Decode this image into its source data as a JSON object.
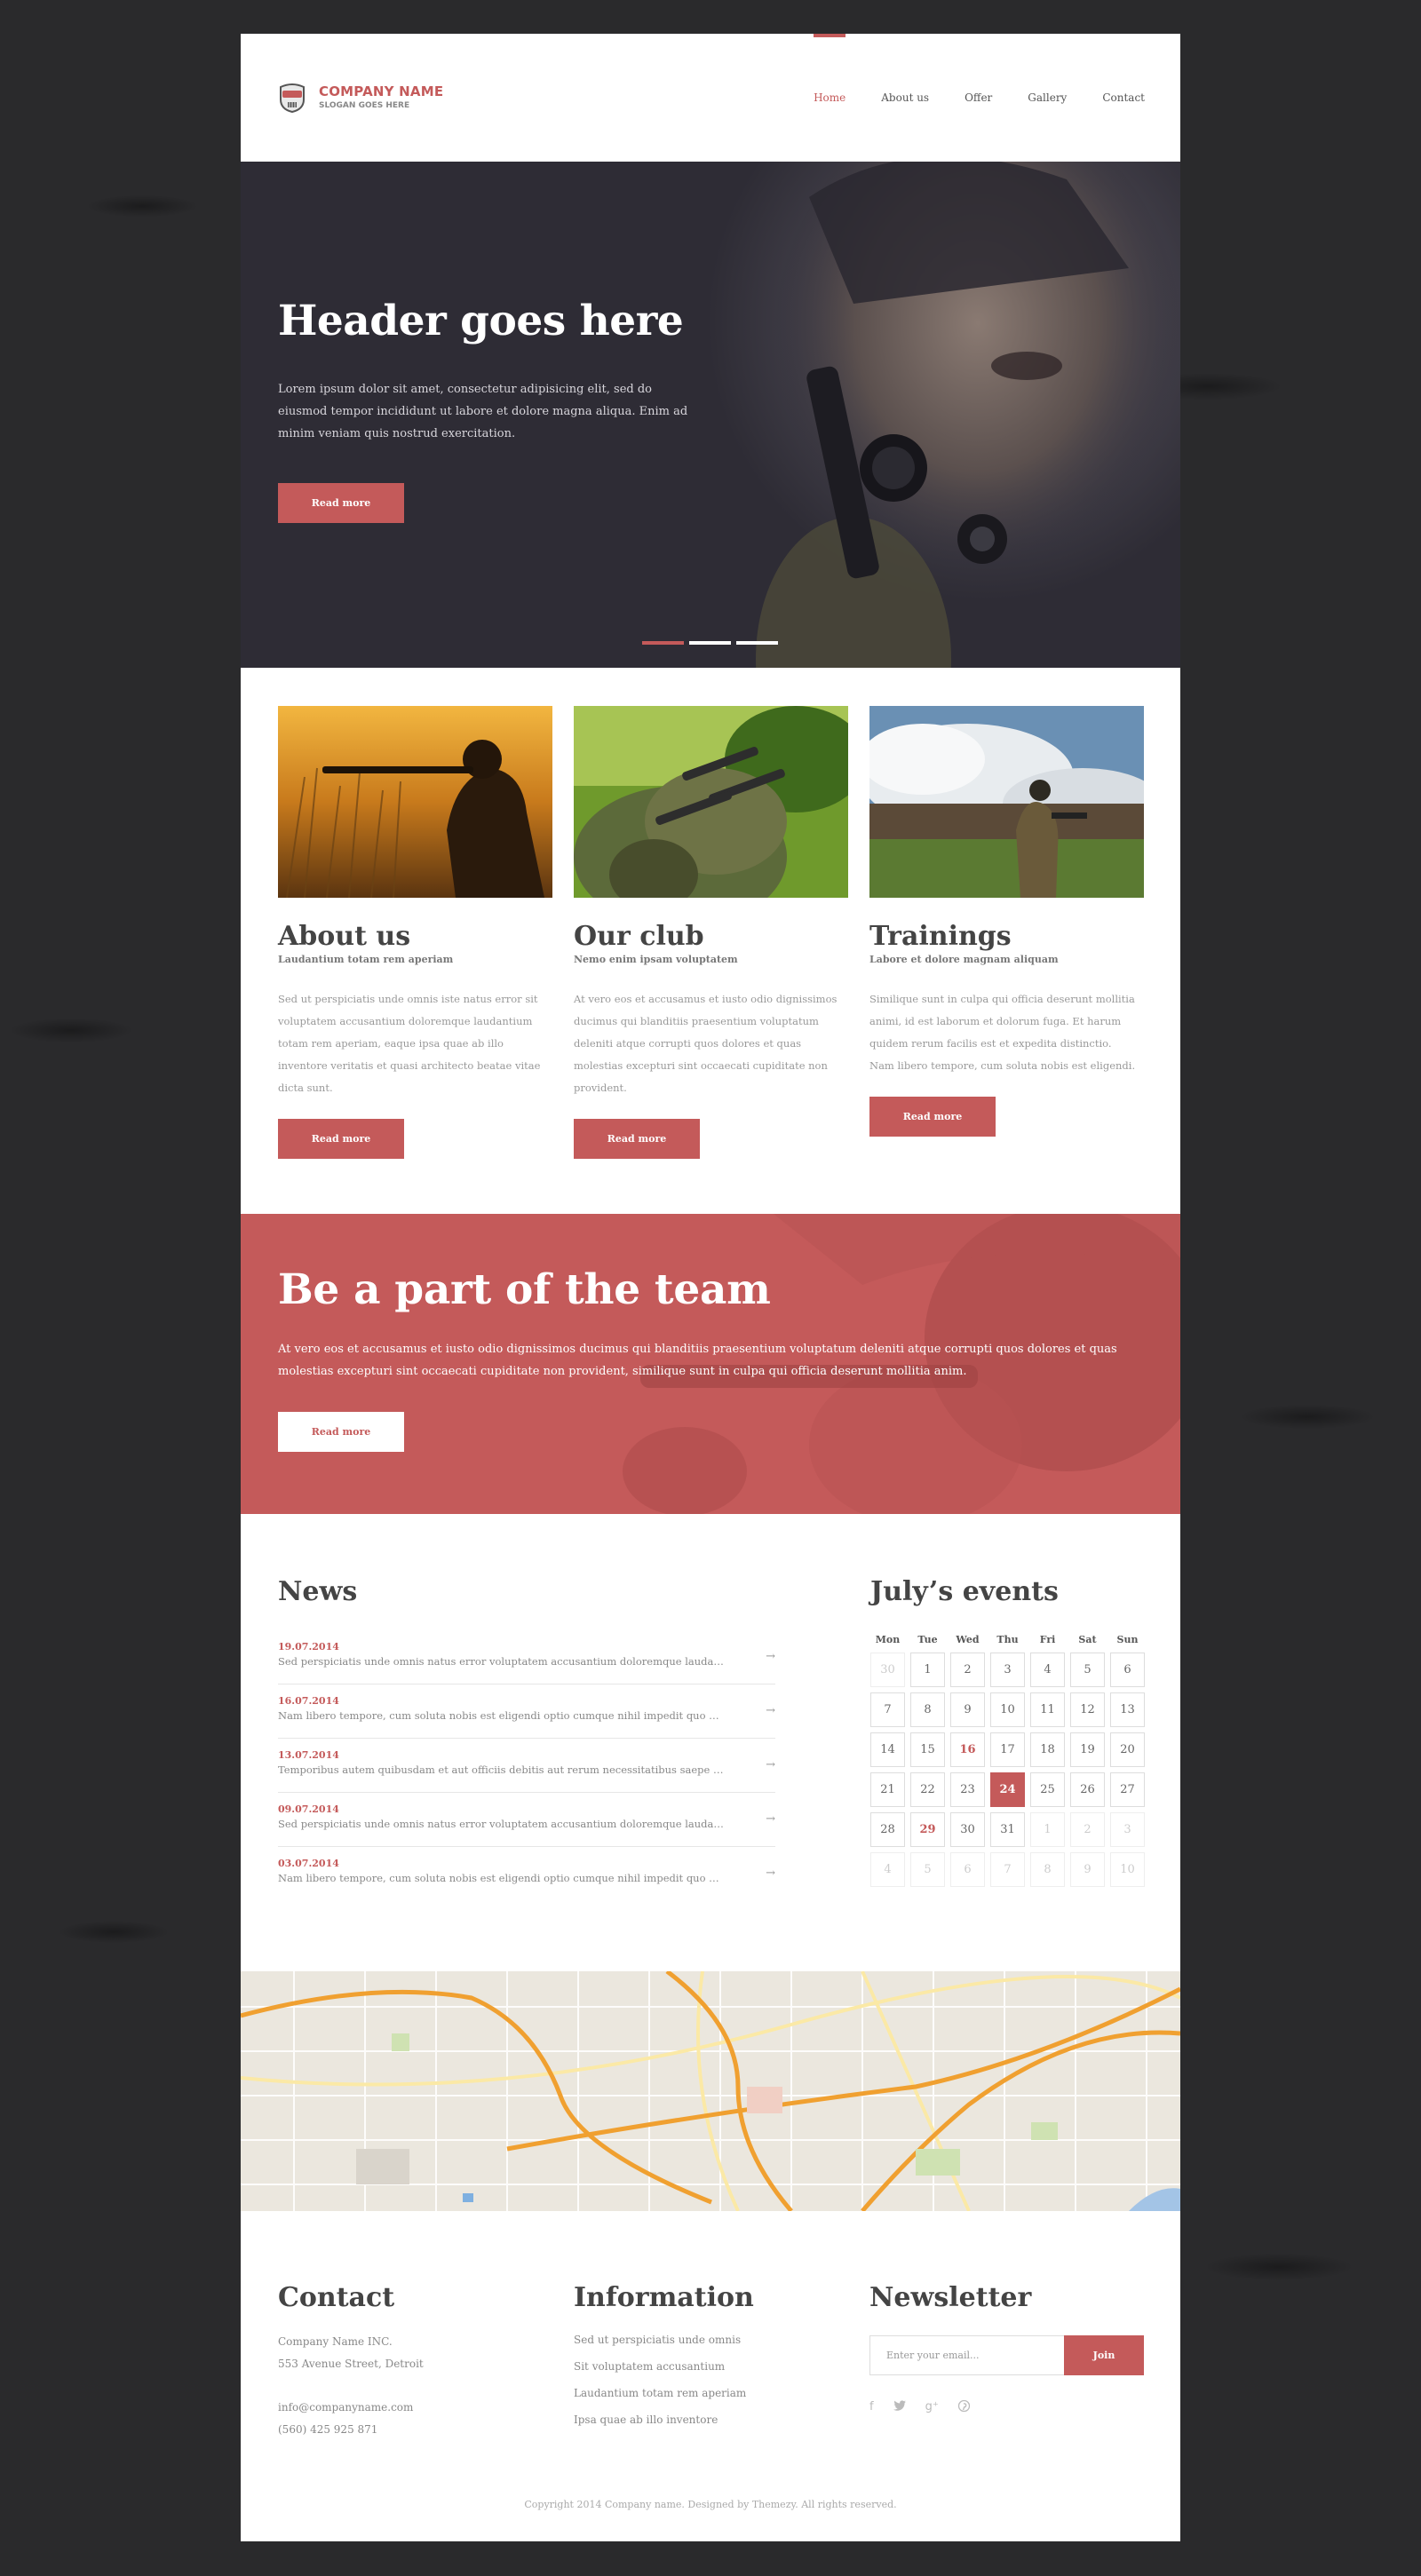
{
  "brand": {
    "name": "COMPANY NAME",
    "slogan": "SLOGAN GOES HERE",
    "accent": "#c45a5a"
  },
  "nav": {
    "items": [
      {
        "label": "Home",
        "active": true
      },
      {
        "label": "About us"
      },
      {
        "label": "Offer"
      },
      {
        "label": "Gallery"
      },
      {
        "label": "Contact"
      }
    ]
  },
  "hero": {
    "title": "Header goes here",
    "text": "Lorem ipsum dolor sit amet, consectetur adipisicing elit, sed do eiusmod tempor incididunt ut labore et dolore magna aliqua. Enim ad minim veniam quis nostrud exercitation.",
    "button": "Read more",
    "slides": 3,
    "active_slide": 1
  },
  "features": [
    {
      "title": "About us",
      "subtitle": "Laudantium totam rem aperiam",
      "text": "Sed ut perspiciatis unde omnis iste natus error sit voluptatem accusantium doloremque laudantium totam rem aperiam, eaque ipsa quae ab illo inventore veritatis et quasi architecto beatae vitae dicta sunt.",
      "button": "Read more"
    },
    {
      "title": "Our club",
      "subtitle": "Nemo enim ipsam voluptatem",
      "text": "At vero eos et accusamus et iusto odio dignissimos ducimus qui blanditiis praesentium voluptatum deleniti atque corrupti quos dolores et quas molestias excepturi sint occaecati cupiditate non provident.",
      "button": "Read more"
    },
    {
      "title": "Trainings",
      "subtitle": "Labore et dolore magnam aliquam",
      "text": "Similique sunt in culpa qui officia deserunt mollitia animi, id est laborum et dolorum fuga. Et harum quidem rerum facilis est et expedita distinctio. Nam libero tempore, cum soluta nobis est eligendi.",
      "button": "Read more"
    }
  ],
  "team": {
    "title": "Be a part of the team",
    "text": "At vero eos et accusamus et iusto odio dignissimos ducimus qui blanditiis praesentium voluptatum deleniti atque corrupti quos dolores et quas molestias excepturi sint occaecati cupiditate non provident, similique sunt in culpa qui officia deserunt mollitia anim.",
    "button": "Read more"
  },
  "news": {
    "title": "News",
    "items": [
      {
        "date": "19.07.2014",
        "text": "Sed perspiciatis unde omnis natus error voluptatem accusantium doloremque laudantium..."
      },
      {
        "date": "16.07.2014",
        "text": "Nam libero tempore, cum soluta nobis est eligendi optio cumque nihil impedit quo minus..."
      },
      {
        "date": "13.07.2014",
        "text": "Temporibus autem quibusdam et aut officiis debitis aut rerum necessitatibus saepe eveniet..."
      },
      {
        "date": "09.07.2014",
        "text": "Sed perspiciatis unde omnis natus error voluptatem accusantium doloremque laudantium..."
      },
      {
        "date": "03.07.2014",
        "text": "Nam libero tempore, cum soluta nobis est eligendi optio cumque nihil impedit quo minus..."
      }
    ]
  },
  "events": {
    "title": "July’s events",
    "days_of_week": [
      "Mon",
      "Tue",
      "Wed",
      "Thu",
      "Fri",
      "Sat",
      "Sun"
    ],
    "weeks": [
      [
        {
          "d": "30",
          "m": true
        },
        {
          "d": "1"
        },
        {
          "d": "2"
        },
        {
          "d": "3"
        },
        {
          "d": "4"
        },
        {
          "d": "5"
        },
        {
          "d": "6"
        }
      ],
      [
        {
          "d": "7"
        },
        {
          "d": "8"
        },
        {
          "d": "9"
        },
        {
          "d": "10"
        },
        {
          "d": "11"
        },
        {
          "d": "12"
        },
        {
          "d": "13"
        }
      ],
      [
        {
          "d": "14"
        },
        {
          "d": "15"
        },
        {
          "d": "16",
          "e": true
        },
        {
          "d": "17"
        },
        {
          "d": "18"
        },
        {
          "d": "19"
        },
        {
          "d": "20"
        }
      ],
      [
        {
          "d": "21"
        },
        {
          "d": "22"
        },
        {
          "d": "23"
        },
        {
          "d": "24",
          "t": true
        },
        {
          "d": "25"
        },
        {
          "d": "26"
        },
        {
          "d": "27"
        }
      ],
      [
        {
          "d": "28"
        },
        {
          "d": "29",
          "e": true
        },
        {
          "d": "30"
        },
        {
          "d": "31"
        },
        {
          "d": "1",
          "m": true
        },
        {
          "d": "2",
          "m": true
        },
        {
          "d": "3",
          "m": true
        }
      ],
      [
        {
          "d": "4",
          "m": true
        },
        {
          "d": "5",
          "m": true
        },
        {
          "d": "6",
          "m": true
        },
        {
          "d": "7",
          "m": true
        },
        {
          "d": "8",
          "m": true
        },
        {
          "d": "9",
          "m": true
        },
        {
          "d": "10",
          "m": true
        }
      ]
    ]
  },
  "footer": {
    "contact": {
      "title": "Contact",
      "company": "Company Name INC.",
      "address": "553 Avenue Street, Detroit",
      "email": "info@companyname.com",
      "phone": "(560) 425 925 871"
    },
    "information": {
      "title": "Information",
      "links": [
        "Sed ut perspiciatis unde omnis",
        "Sit voluptatem accusantium",
        "Laudantium totam rem aperiam",
        "Ipsa quae ab illo inventore"
      ]
    },
    "newsletter": {
      "title": "Newsletter",
      "placeholder": "Enter your email...",
      "button": "Join",
      "socials": [
        "facebook-icon",
        "twitter-icon",
        "google-plus-icon",
        "pinterest-icon"
      ]
    },
    "copyright": "Copyright 2014 Company name. Designed by Themezy. All rights reserved."
  }
}
